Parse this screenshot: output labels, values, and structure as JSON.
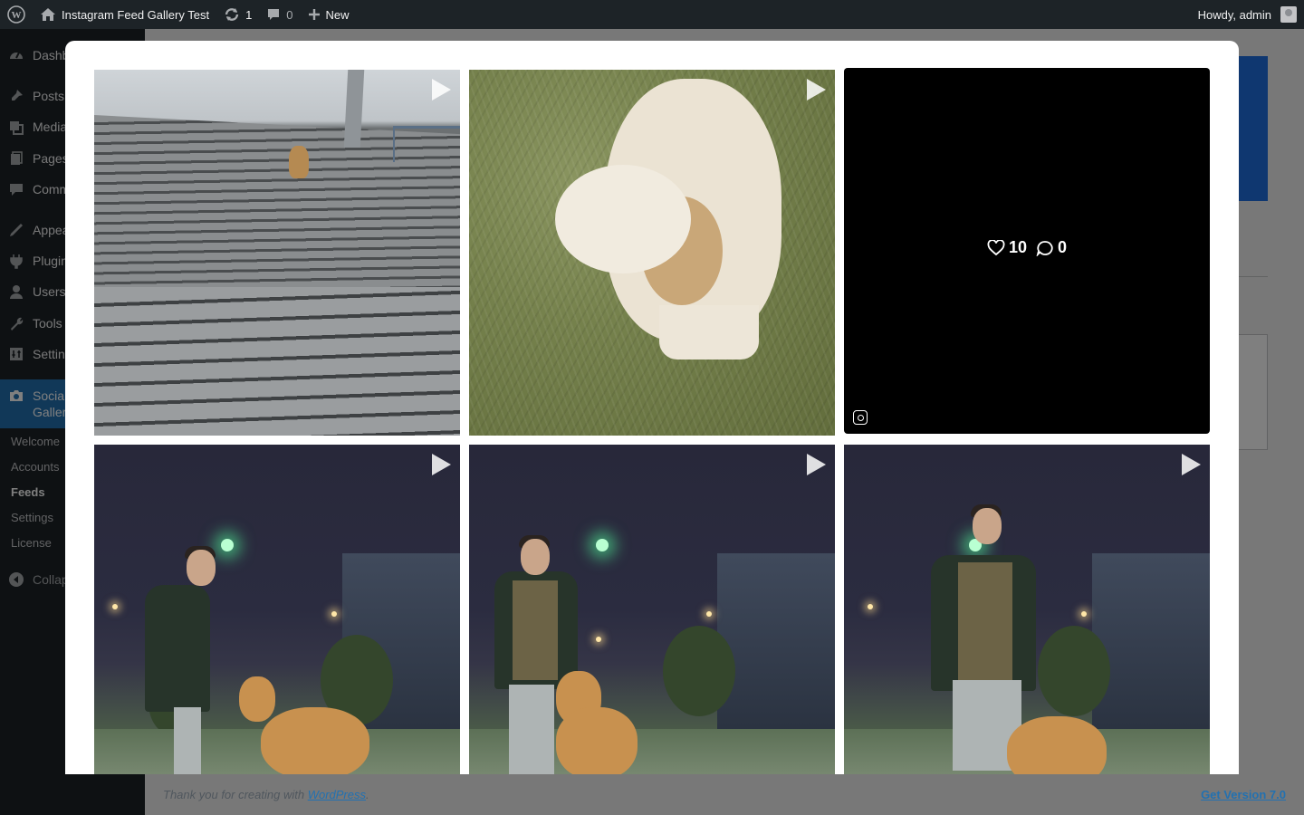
{
  "adminbar": {
    "site_name": "Instagram Feed Gallery Test",
    "updates_count": "1",
    "comments_count": "0",
    "new_label": "New",
    "howdy": "Howdy, admin"
  },
  "sidebar": {
    "items": [
      {
        "label": "Dashb",
        "icon": "dashboard-icon"
      },
      {
        "label": "Posts",
        "icon": "pin-icon"
      },
      {
        "label": "Media",
        "icon": "media-icon"
      },
      {
        "label": "Pages",
        "icon": "pages-icon"
      },
      {
        "label": "Comm",
        "icon": "comments-icon"
      },
      {
        "label": "Appea",
        "icon": "appearance-icon"
      },
      {
        "label": "Plugin",
        "icon": "plugins-icon"
      },
      {
        "label": "Users",
        "icon": "users-icon"
      },
      {
        "label": "Tools",
        "icon": "tools-icon"
      },
      {
        "label": "Settin",
        "icon": "settings-icon"
      }
    ],
    "active_item": {
      "line1": "Socia",
      "line2": "Galler",
      "icon": "camera-icon"
    },
    "submenu": [
      "Welcome",
      "Accounts",
      "Feeds",
      "Settings",
      "License"
    ],
    "current_submenu": "Feeds",
    "collapse_label": "Collap"
  },
  "gallery": {
    "hover_tile": {
      "likes": "10",
      "comments": "0"
    }
  },
  "footer": {
    "thanks_prefix": "Thank you for creating with ",
    "wp_link": "WordPress",
    "thanks_suffix": ".",
    "version_link": "Get Version 7.0"
  },
  "colors": {
    "admin_bg": "#1d2327",
    "active_menu": "#2271b1",
    "link": "#2271b1",
    "promo_blue": "#1e6fe0"
  }
}
